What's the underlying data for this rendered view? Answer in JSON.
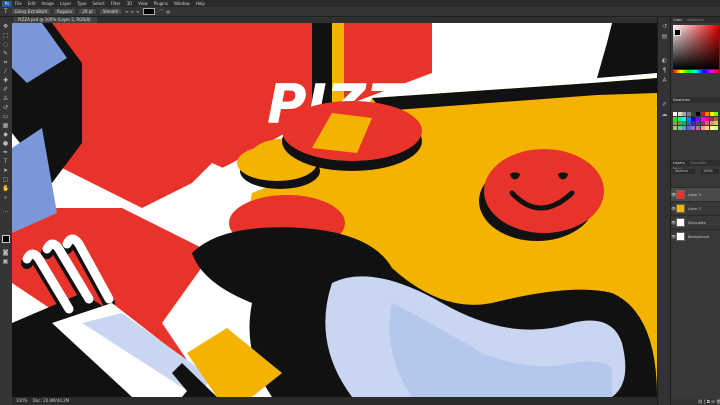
{
  "app": {
    "logo": "Ps"
  },
  "menu": [
    "File",
    "Edit",
    "Image",
    "Layer",
    "Type",
    "Select",
    "Filter",
    "3D",
    "View",
    "Plugins",
    "Window",
    "Help"
  ],
  "options": {
    "tool_icon": "type-tool-icon",
    "font_family": "Gilroy ExtraBold",
    "font_style": "Regular",
    "font_size": "20 pt",
    "anti_alias": "Smooth"
  },
  "document_tab": "PIZZA.psd @ 100% (Layer 2, RGB/8)",
  "status": {
    "zoom": "100%",
    "doc_size": "Doc: 20.8M/44.2M"
  },
  "panels": {
    "color_tabs": [
      "Color",
      "Swatches"
    ],
    "swatch_tabs": [
      "Swatches"
    ],
    "layers_tabs": [
      "Layers",
      "Channels",
      "Paths"
    ],
    "blend_mode": "Normal",
    "opacity": "100%"
  },
  "swatches": [
    "#ffffff",
    "#d9d9d9",
    "#a6a6a6",
    "#7f7f7f",
    "#404040",
    "#000000",
    "#ff0000",
    "#ff7f00",
    "#ffff00",
    "#7fff00",
    "#00ff00",
    "#00ff7f",
    "#00ffff",
    "#007fff",
    "#0000ff",
    "#7f00ff",
    "#ff00ff",
    "#ff007f",
    "#993333",
    "#996633",
    "#999933",
    "#669933",
    "#339966",
    "#336699",
    "#333399",
    "#663399",
    "#993366",
    "#cc6666",
    "#cc9966",
    "#cccc66",
    "#99cc66",
    "#66cc99",
    "#6699cc",
    "#6666cc",
    "#9966cc",
    "#cc6699",
    "#ff9999",
    "#ffcc99",
    "#ffff99",
    "#ccff99"
  ],
  "layers": [
    {
      "name": "Layer 3",
      "thumb": "#e8332a",
      "selected": true
    },
    {
      "name": "Layer 2",
      "thumb": "#f5b301",
      "selected": false
    },
    {
      "name": "Silhouette",
      "thumb": "#ffffff",
      "selected": false
    },
    {
      "name": "Background",
      "thumb": "#ffffff",
      "selected": false
    }
  ],
  "artwork": {
    "word": "PIZZA",
    "red": "#e8332a",
    "yellow": "#f5b301",
    "black": "#111111",
    "blue": "#7b97d9",
    "plate": "#c9d6f2",
    "white": "#ffffff"
  }
}
